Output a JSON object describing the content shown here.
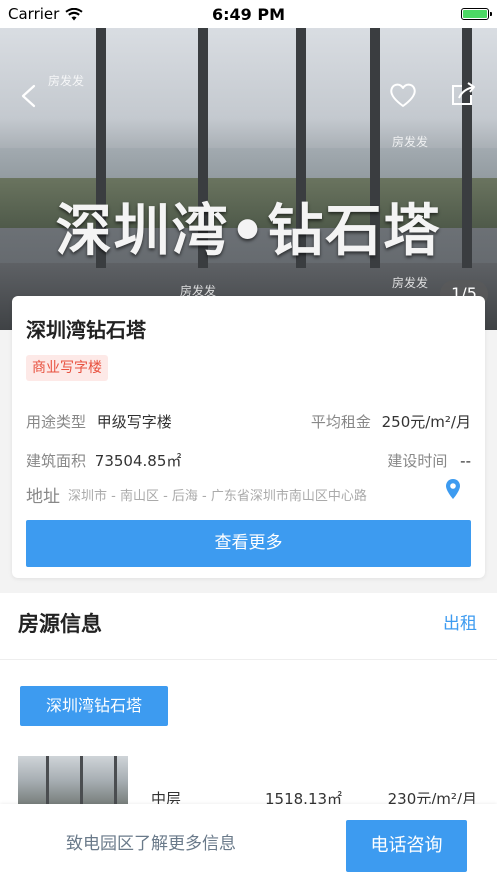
{
  "status_bar": {
    "carrier": "Carrier",
    "time": "6:49 PM",
    "battery_color": "#4cd964"
  },
  "hero": {
    "image_text": "深圳湾•钻石塔",
    "watermark": "房发发",
    "page_indicator": "1/5",
    "icons": {
      "back": "chevron-left-icon",
      "favorite": "heart-icon",
      "share": "share-icon"
    }
  },
  "info_card": {
    "name": "深圳湾钻石塔",
    "category_tag": "商业写字楼",
    "usage_label": "用途类型",
    "usage_value": "甲级写字楼",
    "avg_rent_label": "平均租金",
    "avg_rent_value": "250元/m²/月",
    "area_label": "建筑面积",
    "area_value": "73504.85㎡",
    "build_time_label": "建设时间",
    "build_time_value": "--",
    "address_label": "地址",
    "address_value": "深圳市 - 南山区 - 后海 - 广东省深圳市南山区中心路",
    "more_button": "查看更多"
  },
  "listing_section": {
    "title": "房源信息",
    "link": "出租",
    "building_chip": "深圳湾钻石塔",
    "unit": {
      "floor": "中层",
      "area": "1518.13㎡",
      "price": "230元/m²/月"
    }
  },
  "bottom_bar": {
    "contact_text": "致电园区了解更多信息",
    "call_button": "电话咨询"
  },
  "colors": {
    "accent": "#3d9bf0",
    "tag_bg": "#fde9e7",
    "tag_text": "#e8513f"
  }
}
